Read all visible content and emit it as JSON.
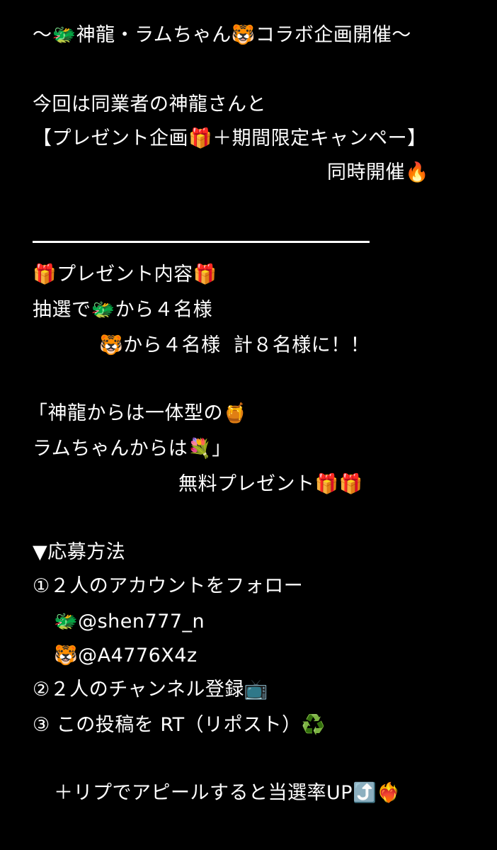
{
  "post": {
    "title": "〜🐲神龍・ラムちゃん🐯コラボ企画開催〜",
    "intro_1": "今回は同業者の神龍さんと",
    "intro_2": "【プレゼント企画🎁＋期間限定キャンペー】",
    "intro_3": "同時開催🔥",
    "present_header": "🎁プレゼント内容🎁",
    "present_1": "抽選で🐲から４名様",
    "present_2": "🐯から４名様  計８名様に！！",
    "gift_1": "「神龍からは一体型の🍯",
    "gift_2": "ラムちゃんからは💐」",
    "gift_3": "無料プレゼント🎁🎁",
    "howto_header": "▼応募方法",
    "step_1": "①２人のアカウントをフォロー",
    "account_1": "🐲@shen777_n",
    "account_2": "🐯@A4776X4z",
    "step_2": "②２人のチャンネル登録📺",
    "step_3": "③ この投稿を RT（リポスト）♻️",
    "footer": "＋リプでアピールすると当選率UP⤴️❤️‍🔥"
  },
  "colors": {
    "background": "#000000",
    "text": "#ffffff"
  }
}
